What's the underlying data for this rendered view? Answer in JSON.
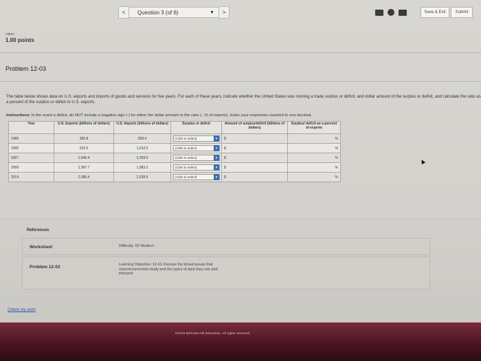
{
  "nav": {
    "question_label": "Question 3 (of 6)",
    "prev_glyph": "<",
    "next_glyph": ">",
    "caret": "▼",
    "save_exit_label": "Save & Exit",
    "submit_label": "Submit"
  },
  "question": {
    "value_label": "value:",
    "points": "1.00 points",
    "problem_title": "Problem 12-03",
    "description": "The table below shows data on U.S. exports and imports of goods and services for five years. For each of these years, indicate whether the United States was running a trade surplus or deficit, and dollar amount of the surplus or deficit, and calculate the ratio as a percent of the surplus or deficit to U.S. exports.",
    "instructions_label": "Instructions:",
    "instructions_text": " In the event a deficit, do NOT include a negative sign (-) for either the dollar amount or the ratio (...% of exports). Enter your responses rounded to one decimal."
  },
  "table": {
    "headers": [
      "Year",
      "U.S. Exports (billions of dollars)",
      "U.S. Imports (billions of dollars)",
      "Surplus or deficit",
      "Amount of surplus/deficit (billions of dollars)",
      "Surplus/ deficit as a percent of exports"
    ],
    "select_placeholder": "(Click to select)",
    "dollar_sign": "$",
    "percent_sign": "%",
    "rows": [
      {
        "year": "1985",
        "exports": "382.8",
        "imports": "558.4"
      },
      {
        "year": "1995",
        "exports": "911.5",
        "imports": "1,012.5"
      },
      {
        "year": "2007",
        "exports": "1,646.4",
        "imports": "2,359.0"
      },
      {
        "year": "2009",
        "exports": "1,587.7",
        "imports": "1,983.2"
      },
      {
        "year": "2014",
        "exports": "2,086.4",
        "imports": "2,528.9"
      }
    ]
  },
  "references": {
    "title": "References",
    "worksheet_label": "Worksheet",
    "difficulty": "Difficulty: 02 Medium",
    "problem_label": "Problem 12-03",
    "objective": "Learning Objective: 12-01 Discuss the broad issues that macroeconomists study and the types of data they use and interpret."
  },
  "check_link": "Check my work",
  "footer": {
    "copyright": "©2018 McGraw-Hill Education. All rights reserved."
  },
  "colors": {
    "accent_blue": "#3b6fb5",
    "footer_maroon": "#4a1522"
  }
}
